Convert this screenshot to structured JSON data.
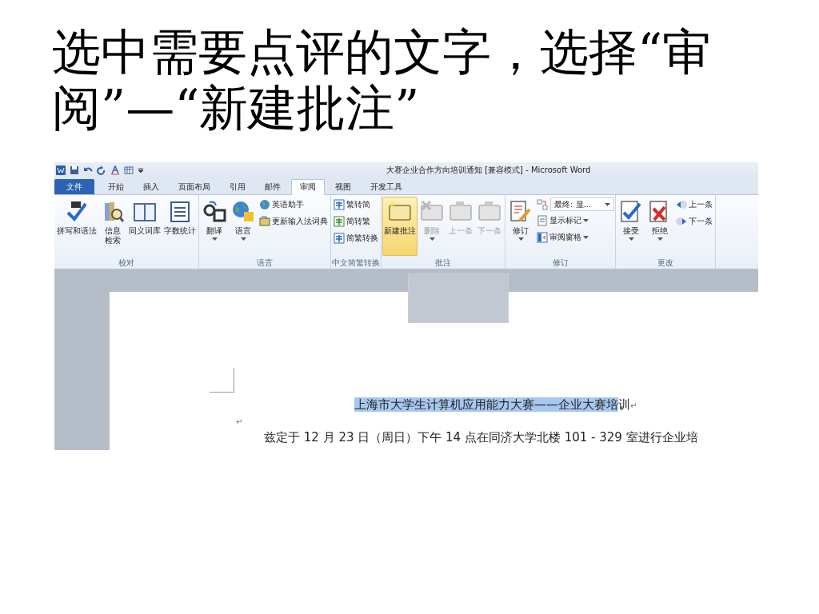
{
  "slide_title": "选中需要点评的文字，选择“审阅”—“新建批注”",
  "window": {
    "title": "大赛企业合作方向培训通知 [兼容模式] - Microsoft Word"
  },
  "ribbon": {
    "tabs": [
      {
        "label": "文件",
        "kind": "file",
        "selected": false
      },
      {
        "label": "开始",
        "kind": "tab",
        "selected": false
      },
      {
        "label": "插入",
        "kind": "tab",
        "selected": false
      },
      {
        "label": "页面布局",
        "kind": "tab",
        "selected": false
      },
      {
        "label": "引用",
        "kind": "tab",
        "selected": false
      },
      {
        "label": "邮件",
        "kind": "tab",
        "selected": false
      },
      {
        "label": "审阅",
        "kind": "tab",
        "selected": true
      },
      {
        "label": "视图",
        "kind": "tab",
        "selected": false
      },
      {
        "label": "开发工具",
        "kind": "tab",
        "selected": false
      }
    ],
    "groups": [
      {
        "label": "校对",
        "items": [
          {
            "kind": "large",
            "label": "拼写和语法",
            "dropdown": false,
            "disabled": false,
            "highlighted": false
          },
          {
            "kind": "large_narrow",
            "label": "信息检索",
            "dropdown": false,
            "disabled": false,
            "highlighted": false
          },
          {
            "kind": "large",
            "label": "同义词库",
            "dropdown": false,
            "disabled": false,
            "highlighted": false
          },
          {
            "kind": "large",
            "label": "字数统计",
            "dropdown": false,
            "disabled": false,
            "highlighted": false
          }
        ]
      },
      {
        "label": "语言",
        "items": [
          {
            "kind": "large",
            "label": "翻译",
            "dropdown": true,
            "disabled": false,
            "highlighted": false
          },
          {
            "kind": "large",
            "label": "语言",
            "dropdown": true,
            "disabled": false,
            "highlighted": false
          },
          {
            "kind": "stack",
            "buttons": [
              {
                "kind": "small",
                "label": "英语助手",
                "dropdown": false
              },
              {
                "kind": "small",
                "label": "更新输入法词典",
                "dropdown": false
              }
            ]
          }
        ]
      },
      {
        "label": "中文简繁转换",
        "items": [
          {
            "kind": "stack",
            "buttons": [
              {
                "kind": "small",
                "label": "繁转简",
                "dropdown": false
              },
              {
                "kind": "small",
                "label": "简转繁",
                "dropdown": false
              },
              {
                "kind": "small",
                "label": "简繁转换",
                "dropdown": false
              }
            ]
          }
        ]
      },
      {
        "label": "批注",
        "items": [
          {
            "kind": "large",
            "label": "新建批注",
            "dropdown": false,
            "disabled": false,
            "highlighted": true
          },
          {
            "kind": "large",
            "label": "删除",
            "dropdown": true,
            "disabled": true,
            "highlighted": false
          },
          {
            "kind": "large",
            "label": "上一条",
            "dropdown": false,
            "disabled": true,
            "highlighted": false
          },
          {
            "kind": "large",
            "label": "下一条",
            "dropdown": false,
            "disabled": true,
            "highlighted": false
          }
        ]
      },
      {
        "label": "修订",
        "items": [
          {
            "kind": "large",
            "label": "修订",
            "dropdown": true,
            "disabled": false,
            "highlighted": false
          },
          {
            "kind": "stack",
            "buttons": [
              {
                "kind": "select",
                "label": "最终: 显...",
                "dropdown": true
              },
              {
                "kind": "small",
                "label": "显示标记",
                "dropdown": true
              },
              {
                "kind": "small",
                "label": "审阅窗格",
                "dropdown": true
              }
            ]
          }
        ]
      },
      {
        "label": "更改",
        "items": [
          {
            "kind": "large",
            "label": "接受",
            "dropdown": true,
            "disabled": false,
            "highlighted": false
          },
          {
            "kind": "large",
            "label": "拒绝",
            "dropdown": true,
            "disabled": false,
            "highlighted": false
          },
          {
            "kind": "stack",
            "buttons": [
              {
                "kind": "small",
                "label": "上一条",
                "dropdown": false
              },
              {
                "kind": "small",
                "label": "下一条",
                "dropdown": false
              }
            ]
          }
        ]
      }
    ]
  },
  "document": {
    "heading": {
      "selected_text": "上海市大学生计算机应用能力大赛——企业大赛培",
      "unselected_text": "训",
      "paragraph_mark": "↵"
    },
    "empty_paragraph_mark": "↵",
    "body_text": "兹定于 12 月 23 日（周日）下午 14 点在同济大学北楼 101 - 329 室进行企业培"
  }
}
